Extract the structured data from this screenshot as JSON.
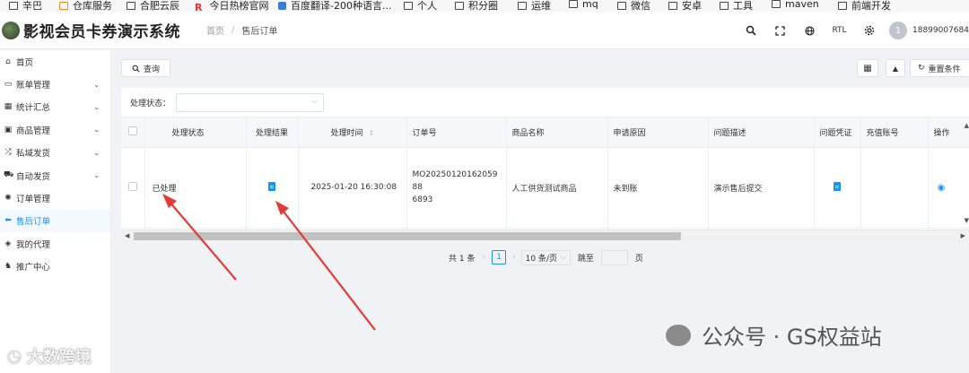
{
  "bookmarks": [
    {
      "label": "辛巴",
      "icon": "folder-icon"
    },
    {
      "label": "仓库服务",
      "icon": "link-icon"
    },
    {
      "label": "合肥云辰",
      "icon": "folder-icon"
    },
    {
      "label": "今日热榜官网",
      "icon": "r-logo-icon"
    },
    {
      "label": "百度翻译-200种语言...",
      "icon": "translate-icon"
    },
    {
      "label": "个人",
      "icon": "folder-icon"
    },
    {
      "label": "积分圈",
      "icon": "folder-icon"
    },
    {
      "label": "运维",
      "icon": "folder-icon"
    },
    {
      "label": "mq",
      "icon": "folder-icon"
    },
    {
      "label": "微信",
      "icon": "folder-icon"
    },
    {
      "label": "安卓",
      "icon": "folder-icon"
    },
    {
      "label": "工具",
      "icon": "folder-icon"
    },
    {
      "label": "maven",
      "icon": "folder-icon"
    },
    {
      "label": "前端开发",
      "icon": "folder-icon"
    }
  ],
  "header": {
    "app_title": "影视会员卡券演示系统",
    "breadcrumb": [
      "首页",
      "售后订单"
    ],
    "rtl_label": "RTL",
    "user_initial": "1",
    "user_name": "18899007684"
  },
  "sidebar": {
    "items": [
      {
        "label": "首页",
        "icon": "home-icon",
        "has_children": false
      },
      {
        "label": "账单管理",
        "icon": "bill-icon",
        "has_children": true
      },
      {
        "label": "统计汇总",
        "icon": "stats-icon",
        "has_children": true
      },
      {
        "label": "商品管理",
        "icon": "calendar-icon",
        "has_children": true
      },
      {
        "label": "私域发货",
        "icon": "shuffle-icon",
        "has_children": true
      },
      {
        "label": "自动发货",
        "icon": "car-icon",
        "has_children": true
      },
      {
        "label": "订单管理",
        "icon": "gear-icon",
        "has_children": false
      },
      {
        "label": "售后订单",
        "icon": "arrow-left-icon",
        "has_children": false,
        "active": true
      },
      {
        "label": "我的代理",
        "icon": "agent-icon",
        "has_children": false
      },
      {
        "label": "推广中心",
        "icon": "promo-icon",
        "has_children": false
      }
    ]
  },
  "toolbar": {
    "search_label": "查询",
    "reset_label": "重置条件"
  },
  "filter": {
    "status_label": "处理状态：",
    "status_value": ""
  },
  "table": {
    "columns": [
      "处理状态",
      "处理结果",
      "处理时间",
      "订单号",
      "商品名称",
      "申请原因",
      "问题描述",
      "问题凭证",
      "充值账号",
      "操作"
    ],
    "rows": [
      {
        "status": "已处理",
        "result_icon": "document-icon",
        "time": "2025-01-20 16:30:08",
        "order_no_line1": "MO20250120162059​88",
        "order_no_line2": "6893",
        "product": "人工供货测试商品",
        "reason": "未到账",
        "description": "演示售后提交",
        "proof_icon": "document-icon",
        "account": "",
        "action_icon": "eye-icon"
      }
    ]
  },
  "pagination": {
    "total_text": "共 1 条",
    "current_page": "1",
    "page_size": "10 条/页",
    "jump_label": "跳至",
    "page_suffix": "页"
  },
  "watermarks": {
    "right": "公众号 · GS权益站",
    "left": "大数跨境"
  },
  "colors": {
    "accent": "#1890ff",
    "arrow": "#e53935"
  }
}
